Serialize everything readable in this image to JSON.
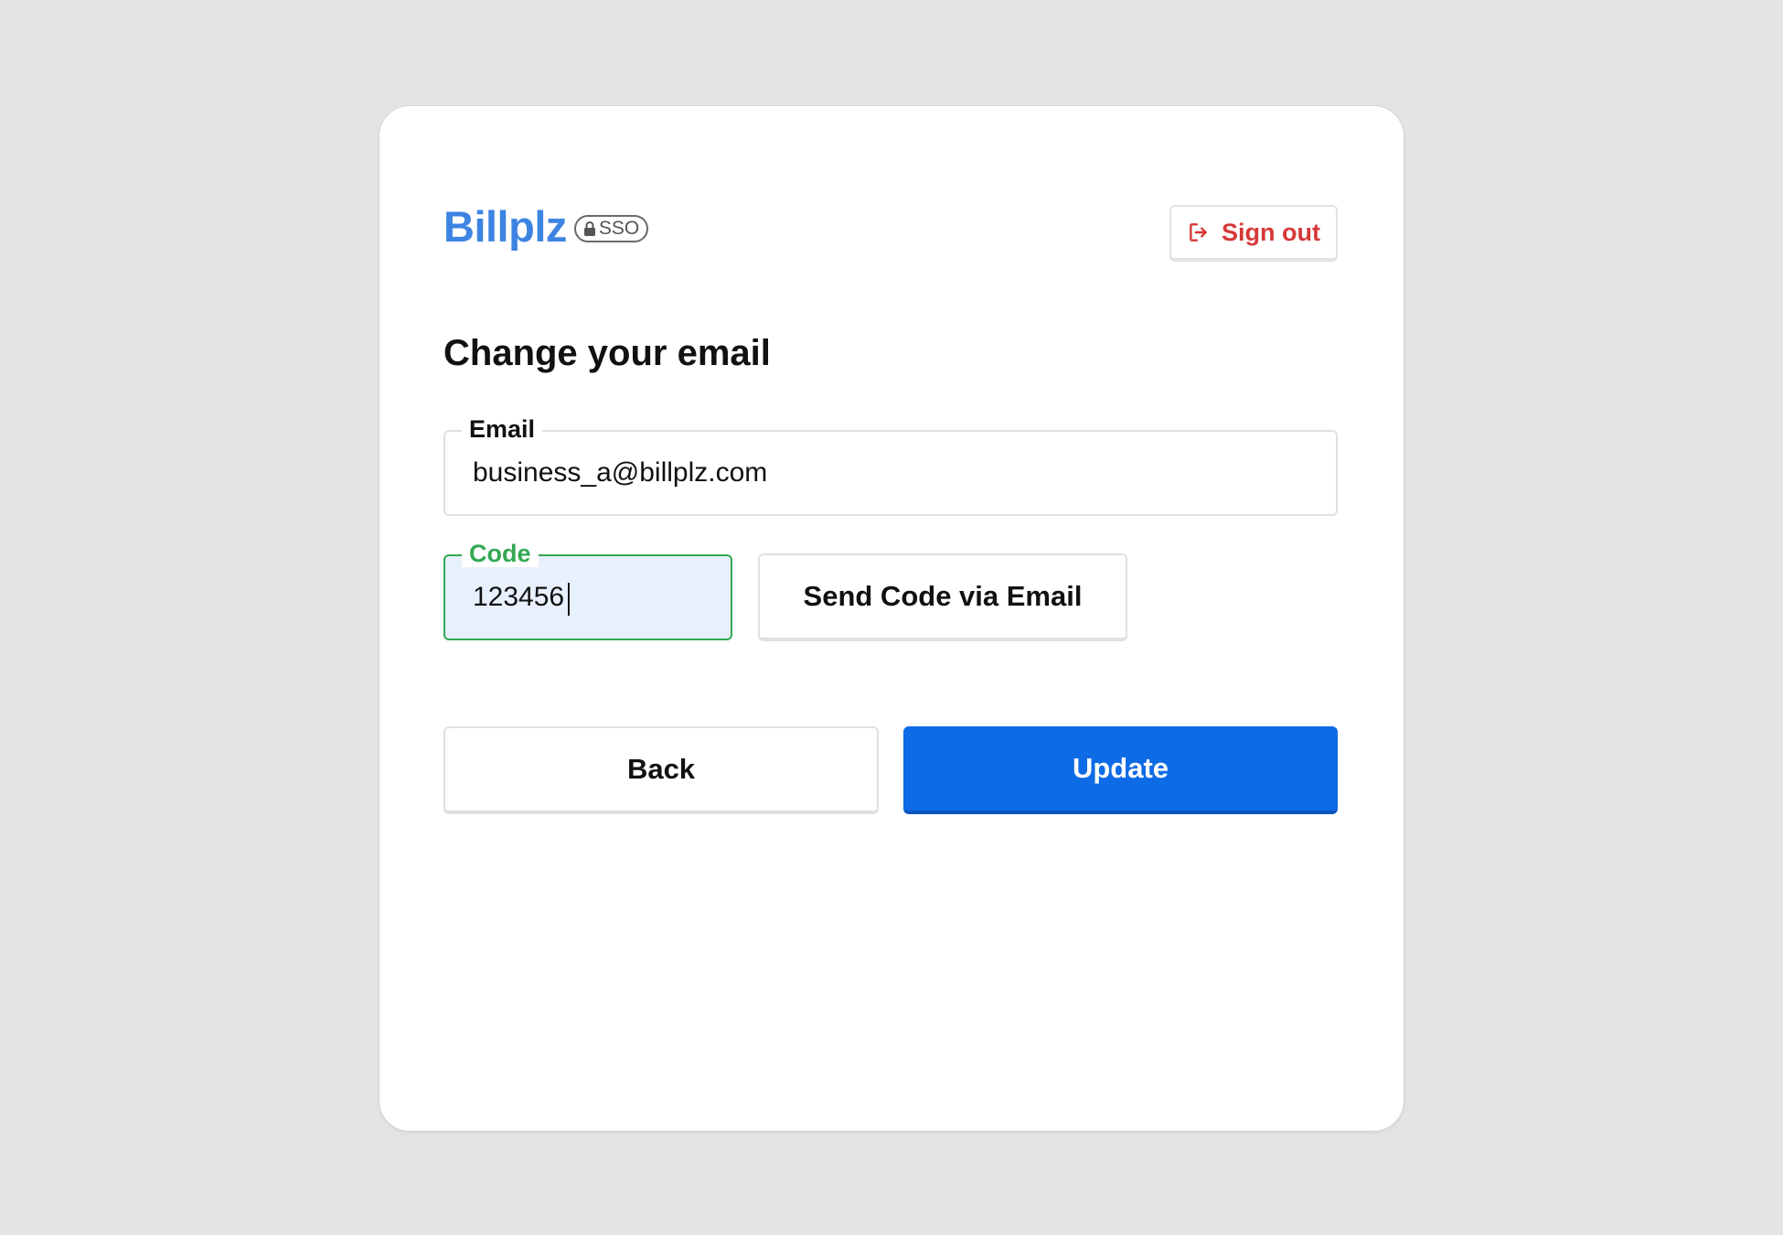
{
  "brand": {
    "name": "Billplz",
    "badge": "SSO"
  },
  "header": {
    "signout_label": "Sign out"
  },
  "page": {
    "title": "Change your email"
  },
  "form": {
    "email": {
      "label": "Email",
      "value": "business_a@billplz.com"
    },
    "code": {
      "label": "Code",
      "value": "123456"
    },
    "send_code_label": "Send Code via Email"
  },
  "actions": {
    "back_label": "Back",
    "update_label": "Update"
  },
  "colors": {
    "brand": "#3d84e2",
    "signout": "#d63838",
    "focus": "#34a853",
    "primary": "#0e6be6",
    "background": "#e4e4e4"
  },
  "icons": {
    "signout": "sign-out-icon",
    "sso": "lock-icon"
  }
}
